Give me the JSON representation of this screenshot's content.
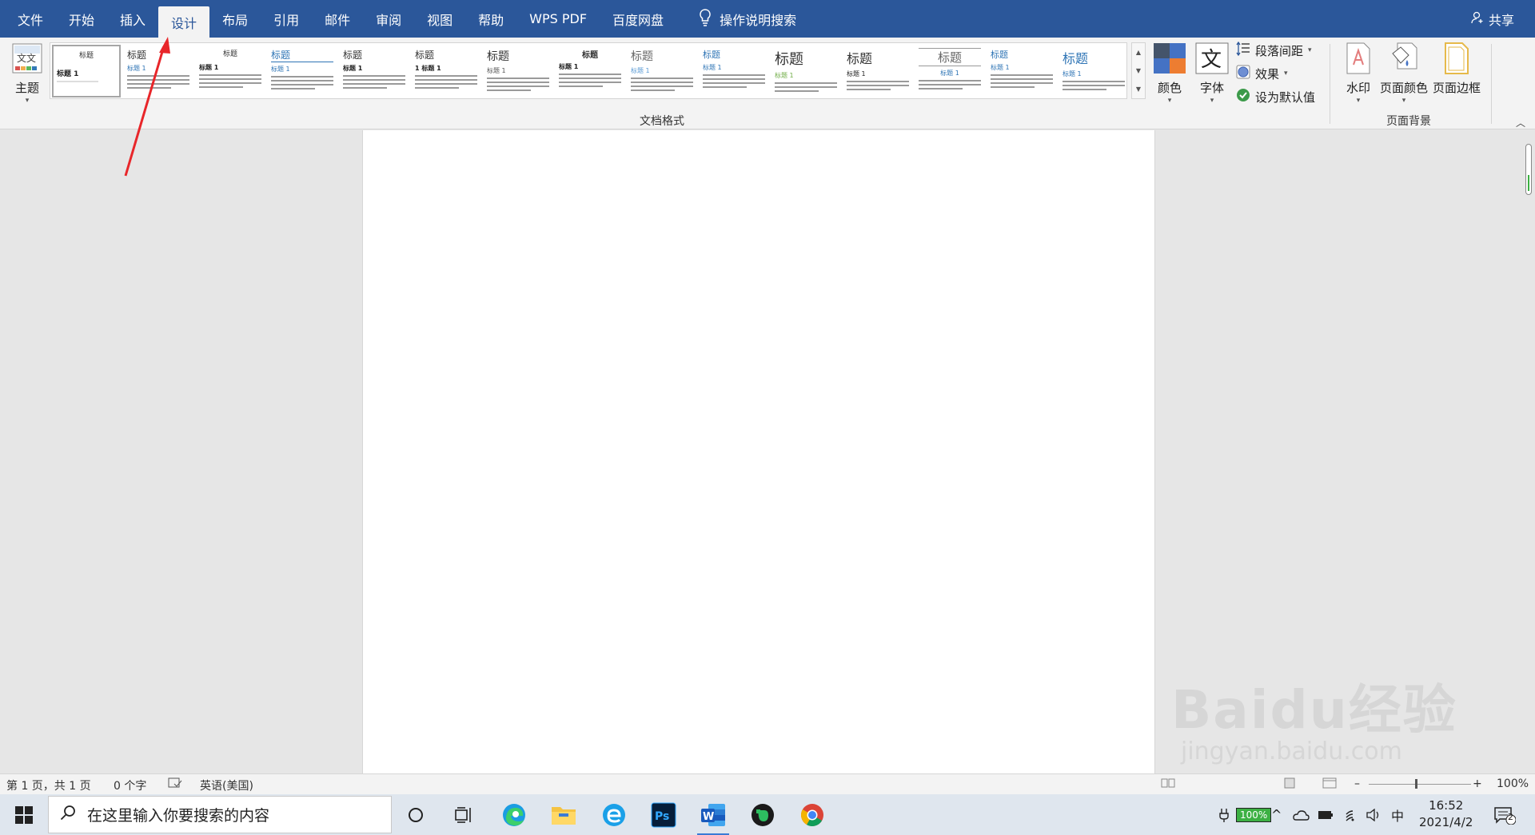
{
  "menu": {
    "tabs": [
      "文件",
      "开始",
      "插入",
      "设计",
      "布局",
      "引用",
      "邮件",
      "审阅",
      "视图",
      "帮助",
      "WPS PDF",
      "百度网盘"
    ],
    "active_tab": "设计",
    "tell_me": "操作说明搜索",
    "share": "共享"
  },
  "ribbon": {
    "theme_label": "主题",
    "gallery_group_label": "文档格式",
    "thumbs": [
      {
        "title": "标题",
        "sub": "标题 1"
      },
      {
        "title": "标题",
        "sub": "标题 1"
      },
      {
        "title": "标题",
        "sub": "标题 1"
      },
      {
        "title": "标题",
        "sub": "标题 1"
      },
      {
        "title": "标题",
        "sub": "标题 1"
      },
      {
        "title": "标题",
        "sub": "1  标题 1"
      },
      {
        "title": "标题",
        "sub": "标题 1"
      },
      {
        "title": "标题",
        "sub": "标题 1"
      },
      {
        "title": "标题",
        "sub": "标题 1"
      },
      {
        "title": "标题",
        "sub": "标题 1"
      },
      {
        "title": "标题",
        "sub": "标题 1"
      },
      {
        "title": "标题",
        "sub": "标题 1"
      },
      {
        "title": "标题",
        "sub": "标题 1"
      },
      {
        "title": "标题",
        "sub": "标题 1"
      },
      {
        "title": "标题",
        "sub": "标题 1"
      }
    ],
    "colors_label": "颜色",
    "fonts_label": "字体",
    "paragraph_spacing_label": "段落间距",
    "effects_label": "效果",
    "set_default_label": "设为默认值",
    "watermark_label": "水印",
    "page_color_label": "页面颜色",
    "page_border_label": "页面边框",
    "page_bg_group_label": "页面背景"
  },
  "status": {
    "page": "第 1 页，共 1 页",
    "words": "0 个字",
    "language": "英语(美国)",
    "zoom": "100%"
  },
  "taskbar": {
    "search_placeholder": "在这里输入你要搜索的内容",
    "battery": "100%",
    "ime": "中",
    "time": "16:52",
    "date": "2021/4/2",
    "notifications": "2"
  },
  "watermark": {
    "brand": "Baidu经验",
    "url": "jingyan.baidu.com"
  },
  "icons": [
    "windows-start-icon",
    "search-icon",
    "cortana-icon",
    "task-view-icon",
    "edge-icon",
    "file-explorer-icon",
    "browser-e-icon",
    "photoshop-icon",
    "word-icon",
    "evernote-icon",
    "chrome-icon",
    "lightbulb-icon",
    "person-icon"
  ],
  "colors": {
    "titlebar": "#2b579a",
    "annotation_arrow": "#e8262a"
  }
}
